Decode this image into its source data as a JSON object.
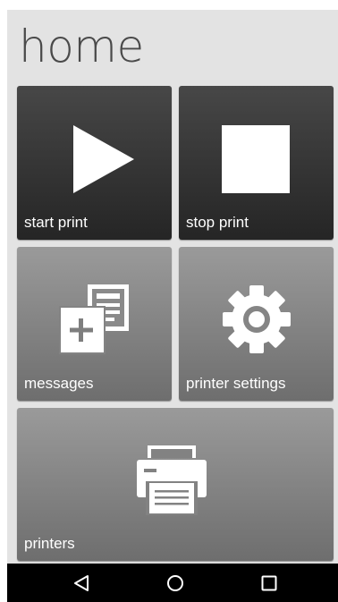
{
  "header": {
    "title": "home"
  },
  "tiles": {
    "start_print": {
      "label": "start print",
      "icon": "play-icon"
    },
    "stop_print": {
      "label": "stop print",
      "icon": "stop-icon"
    },
    "messages": {
      "label": "messages",
      "icon": "messages-icon"
    },
    "printer_settings": {
      "label": "printer settings",
      "icon": "gear-icon"
    },
    "printers": {
      "label": "printers",
      "icon": "printer-icon"
    }
  },
  "navbar": {
    "buttons": [
      "back-icon",
      "home-icon",
      "recents-icon"
    ]
  },
  "colors": {
    "screen_background": "#e3e3e3",
    "tile_dark": "#363636",
    "tile_grey": "#858585",
    "navbar": "#000000",
    "icon": "#ffffff"
  }
}
